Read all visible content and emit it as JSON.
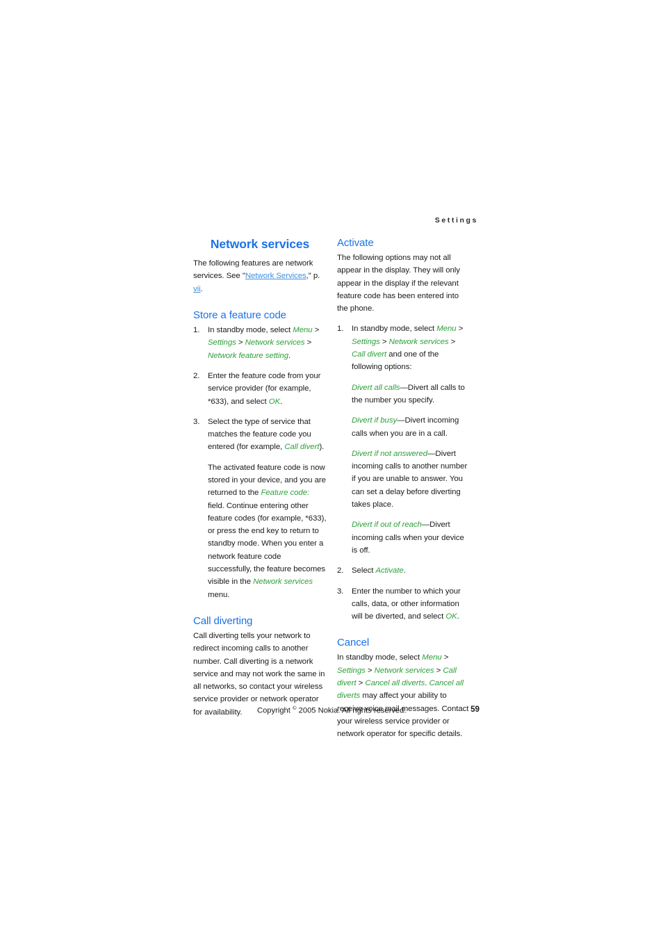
{
  "header": {
    "running_head": "Settings"
  },
  "chapter": {
    "title": "Network services"
  },
  "left_column": {
    "intro": {
      "text_before": "The following features are network services. See \"",
      "link": "Network Services",
      "text_mid": ",\" p. ",
      "link2": "vii",
      "text_after": "."
    },
    "section_store": {
      "heading": "Store a feature code",
      "steps": [
        {
          "num": "1.",
          "parts": [
            {
              "t": "In standby mode, select ",
              "k": "plain"
            },
            {
              "t": "Menu",
              "k": "ui"
            },
            {
              "t": " > ",
              "k": "sep"
            },
            {
              "t": "Settings",
              "k": "ui"
            },
            {
              "t": " > ",
              "k": "sep"
            },
            {
              "t": "Network services",
              "k": "ui"
            },
            {
              "t": " > ",
              "k": "sep"
            },
            {
              "t": "Network feature setting",
              "k": "ui"
            },
            {
              "t": ".",
              "k": "plain"
            }
          ]
        },
        {
          "num": "2.",
          "parts": [
            {
              "t": "Enter the feature code from your service provider (for example, *633), and select ",
              "k": "plain"
            },
            {
              "t": "OK",
              "k": "ui"
            },
            {
              "t": ".",
              "k": "plain"
            }
          ]
        },
        {
          "num": "3.",
          "parts": [
            {
              "t": "Select the type of service that matches the feature code you entered (for example, ",
              "k": "plain"
            },
            {
              "t": "Call divert",
              "k": "ui"
            },
            {
              "t": ").",
              "k": "plain"
            }
          ],
          "subparagraph": [
            {
              "t": "The activated feature code is now stored in your device, and you are returned to the ",
              "k": "plain"
            },
            {
              "t": "Feature code:",
              "k": "ui"
            },
            {
              "t": " field. Continue entering other feature codes (for example, *633), or press the end key to return to standby mode. When you enter a network feature code successfully, the feature becomes visible in the ",
              "k": "plain"
            },
            {
              "t": "Network services",
              "k": "ui"
            },
            {
              "t": " menu.",
              "k": "plain"
            }
          ]
        }
      ]
    },
    "section_divert": {
      "heading": "Call diverting",
      "body": "Call diverting tells your network to redirect incoming calls to another number. Call diverting is a network service and may not work the same in all networks, so contact your wireless service provider or network operator for availability."
    }
  },
  "right_column": {
    "section_activate": {
      "heading": "Activate",
      "body": "The following options may not all appear in the display. They will only appear in the display if the relevant feature code has been entered into the phone.",
      "steps": [
        {
          "num": "1.",
          "parts": [
            {
              "t": "In standby mode, select ",
              "k": "plain"
            },
            {
              "t": "Menu",
              "k": "ui"
            },
            {
              "t": " > ",
              "k": "sep"
            },
            {
              "t": "Settings",
              "k": "ui"
            },
            {
              "t": " > ",
              "k": "sep"
            },
            {
              "t": "Network services",
              "k": "ui"
            },
            {
              "t": " > ",
              "k": "sep"
            },
            {
              "t": "Call divert",
              "k": "ui"
            },
            {
              "t": " and one of the following options:",
              "k": "plain"
            }
          ]
        },
        {
          "num": "2.",
          "parts": [
            {
              "t": "Select ",
              "k": "plain"
            },
            {
              "t": "Activate",
              "k": "ui"
            },
            {
              "t": ".",
              "k": "plain"
            }
          ]
        },
        {
          "num": "3.",
          "parts": [
            {
              "t": "Enter the number to which your calls, data, or other information will be diverted, and select ",
              "k": "plain"
            },
            {
              "t": "OK",
              "k": "ui"
            },
            {
              "t": ".",
              "k": "plain"
            }
          ]
        }
      ],
      "options": [
        {
          "term": "Divert all calls",
          "desc": "—Divert all calls to the number you specify."
        },
        {
          "term": "Divert if busy",
          "desc": "—Divert incoming calls when you are in a call."
        },
        {
          "term": "Divert if not answered",
          "desc": "—Divert incoming calls to another number if you are unable to answer. You can set a delay before diverting takes place."
        },
        {
          "term": "Divert if out of reach",
          "desc": "—Divert incoming calls when your device is off."
        }
      ]
    },
    "section_cancel": {
      "heading": "Cancel",
      "parts": [
        {
          "t": "In standby mode, select ",
          "k": "plain"
        },
        {
          "t": "Menu",
          "k": "ui"
        },
        {
          "t": " > ",
          "k": "sep"
        },
        {
          "t": "Settings",
          "k": "ui"
        },
        {
          "t": " > ",
          "k": "sep"
        },
        {
          "t": "Network services",
          "k": "ui"
        },
        {
          "t": " > ",
          "k": "sep"
        },
        {
          "t": "Call divert",
          "k": "ui"
        },
        {
          "t": " > ",
          "k": "sep"
        },
        {
          "t": "Cancel all diverts",
          "k": "ui"
        },
        {
          "t": ". ",
          "k": "plain"
        },
        {
          "t": "Cancel all diverts",
          "k": "ui"
        },
        {
          "t": " may affect your ability to receive voice mail messages. Contact your wireless service provider or network operator for specific details.",
          "k": "plain"
        }
      ]
    }
  },
  "footer": {
    "copyright_before": "Copyright ",
    "copyright_symbol": "©",
    "copyright_after": " 2005 Nokia. All rights reserved.",
    "page_number": "59"
  },
  "colors": {
    "heading_blue": "#1a72e8",
    "ui_green": "#2fa03c",
    "link_blue": "#3c8fe0",
    "body_text": "#1a1a1a"
  }
}
